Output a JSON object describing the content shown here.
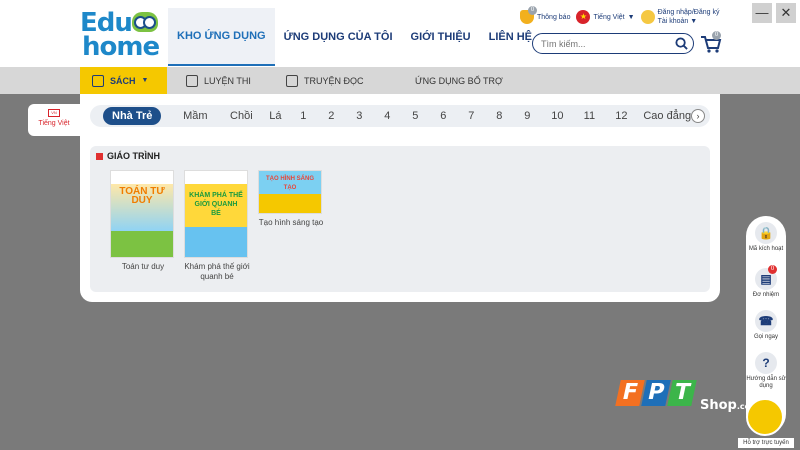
{
  "logo": {
    "line1": "Edu",
    "line2": "home"
  },
  "nav": [
    {
      "label": "KHO ỨNG DỤNG",
      "active": true
    },
    {
      "label": "ỨNG DỤNG CỦA TÔI",
      "active": false
    },
    {
      "label": "GIỚI THIỆU",
      "active": false
    },
    {
      "label": "LIÊN HỆ",
      "active": false
    }
  ],
  "top": {
    "notifications_label": "Thông báo",
    "notifications_count": "0",
    "language_label": "Tiếng Việt",
    "login_line1": "Đăng nhập/Đăng ký",
    "login_line2": "Tài khoản",
    "cart_count": "0"
  },
  "search": {
    "placeholder": "Tìm kiếm..."
  },
  "window": {
    "minimize": "—",
    "close": "✕"
  },
  "subnav": [
    {
      "label": "SÁCH",
      "active": true
    },
    {
      "label": "LUYỆN THI",
      "active": false
    },
    {
      "label": "TRUYỆN ĐỌC",
      "active": false
    },
    {
      "label": "ỨNG DỤNG BỔ TRỢ",
      "active": false
    }
  ],
  "side_language": {
    "flag": "VN",
    "label": "Tiếng Việt"
  },
  "grades": [
    "Nhà Trẻ",
    "Mầm",
    "Chồi",
    "Lá",
    "1",
    "2",
    "3",
    "4",
    "5",
    "6",
    "7",
    "8",
    "9",
    "10",
    "11",
    "12",
    "Cao đẳng"
  ],
  "grade_active": "Nhà Trẻ",
  "section": {
    "title": "GIÁO TRÌNH"
  },
  "books": [
    {
      "title": "Toán tư duy",
      "cover_text": "TOÁN TƯ DUY",
      "color": "#f5a623"
    },
    {
      "title": "Khám phá thế giới quanh bé",
      "cover_text": "KHÁM PHÁ THẾ GIỚI QUANH BÉ",
      "color": "#2ea3dc"
    },
    {
      "title": "Tạo hình sáng tạo",
      "cover_text": "TẠO HÌNH SÁNG TẠO",
      "color": "#e8463a"
    }
  ],
  "float_bar": [
    {
      "label": "Mã kích hoạt",
      "icon": "lock-icon",
      "glyph": "🔒"
    },
    {
      "label": "Đơ nhiệm",
      "icon": "task-icon",
      "glyph": "▤",
      "badge": "0"
    },
    {
      "label": "Gọi ngay",
      "icon": "phone-icon",
      "glyph": "☎"
    },
    {
      "label": "Hướng dẫn sử dụng",
      "icon": "help-icon",
      "glyph": "?"
    }
  ],
  "watermark": {
    "brand": [
      "F",
      "P",
      "T"
    ],
    "shop": "Shop",
    "domain": ".com.vn",
    "support": "Hỗ trợ trực tuyến"
  },
  "colors": {
    "primary": "#1d3c78",
    "accent": "#f5c800",
    "fpt_orange": "#f37021",
    "fpt_blue": "#1e6fb8",
    "fpt_green": "#3cb54a"
  }
}
